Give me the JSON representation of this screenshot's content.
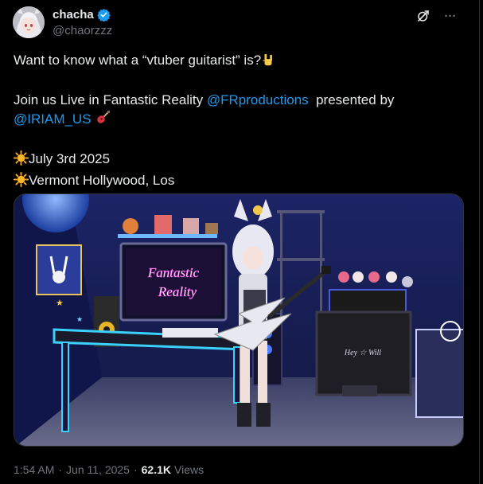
{
  "author": {
    "display_name": "chacha",
    "handle": "@chaorzzz",
    "verified_color": "#1d9bf0"
  },
  "actions": {
    "grok_icon": "grok-icon",
    "more_icon": "more-icon",
    "more_glyph": "···"
  },
  "tweet": {
    "line1_text": "Want to know what a “vtuber guitarist” is?",
    "line1_emoji": "rock-on-hand-icon",
    "line2_prefix": "Join us Live in Fantastic Reality ",
    "line2_mention1": "@FRproductions",
    "line2_suffix": "  presented by",
    "line3_mention2": "@IRIAM_US",
    "line3_emoji": "guitar-icon",
    "line4_emoji": "sun-icon",
    "line4_text": "July 3rd 2025",
    "line5_emoji": "sun-icon",
    "line5_text": "Vermont Hollywood, Los"
  },
  "media": {
    "sign_line1": "Fantastic",
    "sign_line2": "Reality",
    "amp_label": "Hey ☆ Will"
  },
  "meta": {
    "time": "1:54 AM",
    "separator1": "·",
    "date": "Jun 11, 2025",
    "separator2": "·",
    "views_count": "62.1K",
    "views_label": "Views"
  },
  "colors": {
    "link": "#1d9bf0",
    "secondary_text": "#71767b",
    "primary_text": "#e7e9ea",
    "background": "#000000"
  }
}
